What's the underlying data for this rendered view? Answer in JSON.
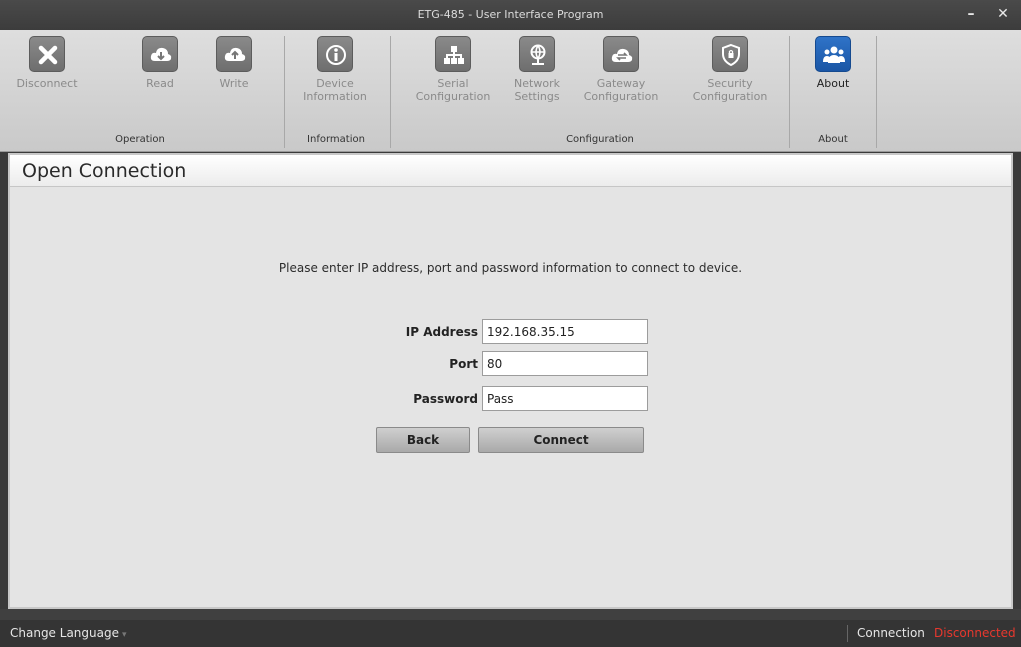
{
  "window": {
    "title": "ETG-485 - User Interface Program",
    "minimize_label": "–",
    "close_label": "✕"
  },
  "ribbon": {
    "buttons": {
      "disconnect": {
        "label": "Disconnect",
        "icon": "close-x-icon"
      },
      "read": {
        "label": "Read",
        "icon": "cloud-download-icon"
      },
      "write": {
        "label": "Write",
        "icon": "cloud-upload-icon"
      },
      "device_information": {
        "label": "Device Information",
        "icon": "info-icon"
      },
      "serial_configuration": {
        "label": "Serial Configuration",
        "icon": "serial-tree-icon"
      },
      "network_settings": {
        "label": "Network Settings",
        "icon": "network-globe-icon"
      },
      "gateway_configuration": {
        "label": "Gateway Configuration",
        "icon": "gateway-cloud-icon"
      },
      "security_configuration": {
        "label": "Security Configuration",
        "icon": "shield-icon"
      },
      "about": {
        "label": "About",
        "icon": "users-icon"
      }
    },
    "groups": {
      "operation": "Operation",
      "information": "Information",
      "configuration": "Configuration",
      "about": "About"
    },
    "active_color": "#1f5fb4"
  },
  "panel": {
    "title": "Open Connection",
    "instruction": "Please enter IP address, port and password information to connect to device.",
    "fields": {
      "ip": {
        "label": "IP Address",
        "value": "192.168.35.15"
      },
      "port": {
        "label": "Port",
        "value": "80"
      },
      "password": {
        "label": "Password",
        "value": "Pass"
      }
    },
    "back_label": "Back",
    "connect_label": "Connect"
  },
  "status": {
    "language_label": "Change Language",
    "connection_label": "Connection",
    "connection_state": "Disconnected",
    "state_color": "#e8382e"
  }
}
